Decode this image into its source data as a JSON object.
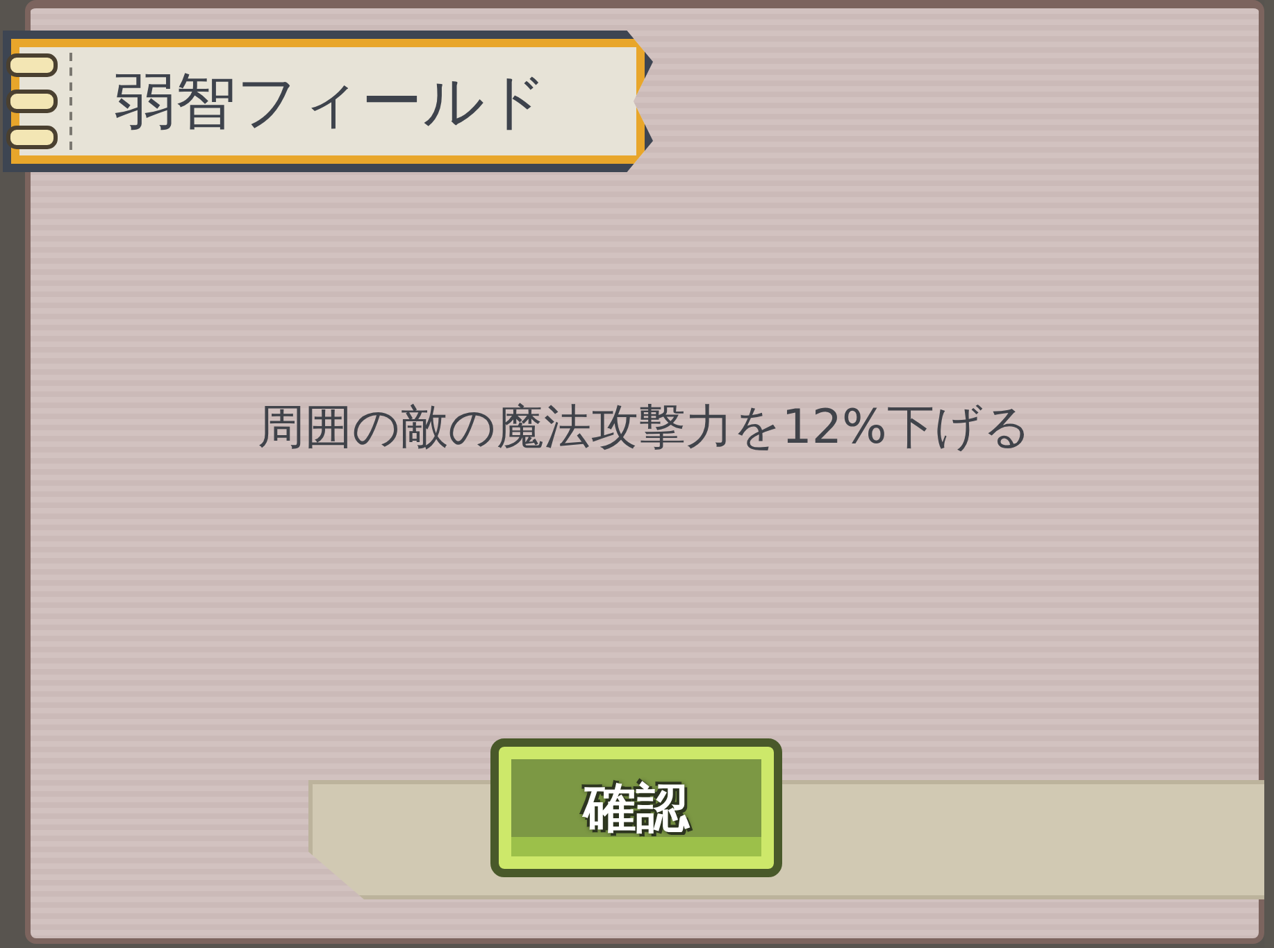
{
  "dialog": {
    "title": "弱智フィールド",
    "description": "周囲の敵の魔法攻撃力を12%下げる",
    "confirm_button": "確認"
  }
}
